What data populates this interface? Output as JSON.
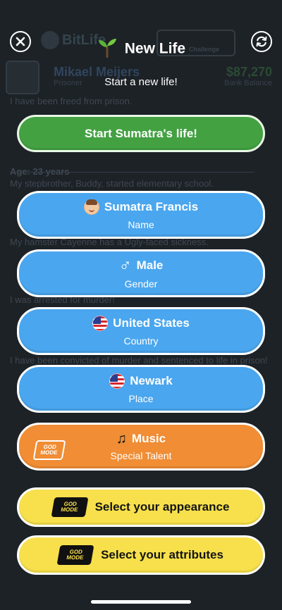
{
  "background": {
    "app_name": "BitLife",
    "challenge_label": "Challenge",
    "character_name": "Mikael Meijers",
    "character_status": "Prisoner",
    "bank_balance": "$87,270",
    "bank_balance_label": "Bank Balance",
    "log_lines": [
      "I have been freed from prison.",
      "Age: 23 years",
      "My stepbrother, Buddy, started elementary school.",
      "My hamster Cayenne has a Ugly-faced sickness.",
      "I was arrested for murder!",
      "I have been convicted of murder and sentenced to life in prison!"
    ]
  },
  "header": {
    "title": "New Life",
    "subtitle": "Start a new life!"
  },
  "start_button": {
    "label": "Start Sumatra's life!"
  },
  "options": {
    "name": {
      "value": "Sumatra Francis",
      "label": "Name"
    },
    "gender": {
      "value": "Male",
      "label": "Gender",
      "symbol": "♂"
    },
    "country": {
      "value": "United States",
      "label": "Country"
    },
    "place": {
      "value": "Newark",
      "label": "Place"
    },
    "talent": {
      "value": "Music",
      "label": "Special Talent",
      "badge": "GOD MODE"
    }
  },
  "god_mode": {
    "appearance_label": "Select your appearance",
    "attributes_label": "Select your attributes",
    "badge": "GOD MODE"
  },
  "colors": {
    "green": "#43a142",
    "blue": "#4aa6ee",
    "orange": "#f08d35",
    "yellow": "#f7e04b",
    "backdrop": "#1d2227"
  }
}
